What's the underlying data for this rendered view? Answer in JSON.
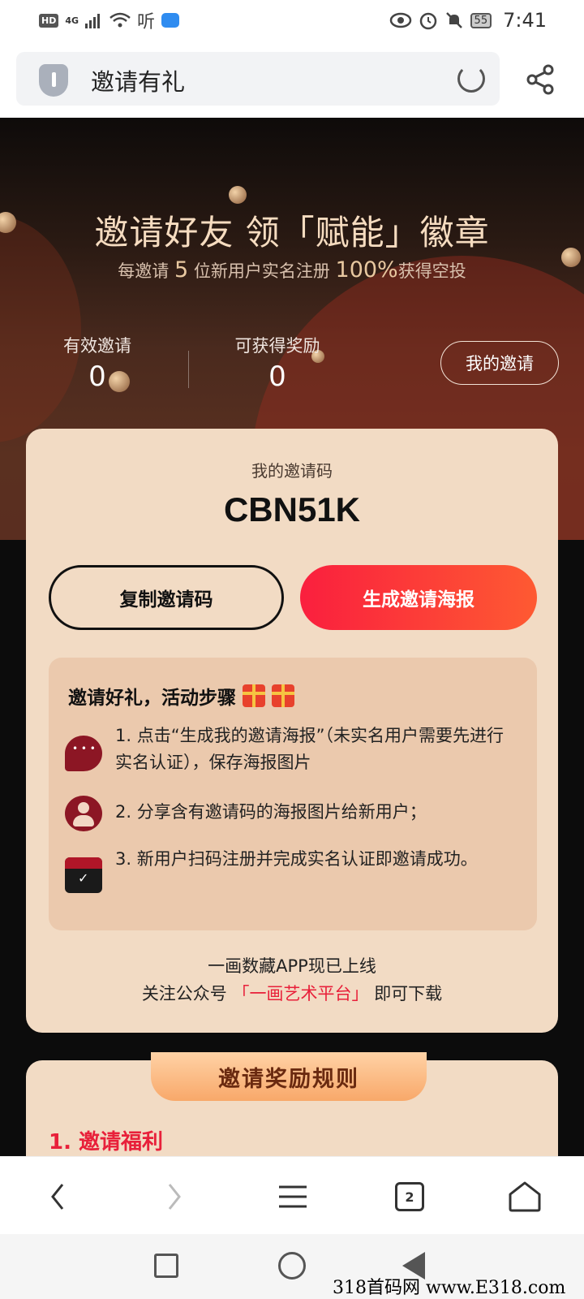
{
  "status_bar": {
    "left_tags": [
      "HD",
      "4G"
    ],
    "ting_glyph": "听",
    "battery": "55",
    "time": "7:41"
  },
  "browser": {
    "page_title": "邀请有礼"
  },
  "hero": {
    "title": "邀请好友 领「赋能」徽章",
    "sub_prefix": "每邀请",
    "sub_count": "5",
    "sub_middle": "位新用户实名注册",
    "sub_percent": "100%",
    "sub_suffix": "获得空投"
  },
  "stats": {
    "valid_invites_label": "有效邀请",
    "valid_invites_value": "0",
    "rewards_label": "可获得奖励",
    "rewards_value": "0",
    "my_invites_button": "我的邀请"
  },
  "invite_card": {
    "code_label": "我的邀请码",
    "code_value": "CBN51K",
    "copy_button": "复制邀请码",
    "poster_button": "生成邀请海报",
    "steps_title": "邀请好礼，活动步骤",
    "steps": [
      {
        "icon": "chat-bubble-icon",
        "text": "1. 点击“生成我的邀请海报”（未实名用户需要先进行实名认证），保存海报图片"
      },
      {
        "icon": "user-icon",
        "text": "2. 分享含有邀请码的海报图片给新用户；"
      },
      {
        "icon": "gift-box-icon",
        "text": "3. 新用户扫码注册并完成实名认证即邀请成功。"
      }
    ],
    "footer_line1": "一画数藏APP现已上线",
    "footer_prefix": "关注公众号",
    "footer_highlight": "「一画艺术平台」",
    "footer_suffix": "即可下载"
  },
  "rules": {
    "tab_label": "邀请奖励规则",
    "heading": "1. 邀请福利"
  },
  "browser_nav": {
    "tab_count": "2"
  },
  "watermark": "318首码网 www.E318.com"
}
